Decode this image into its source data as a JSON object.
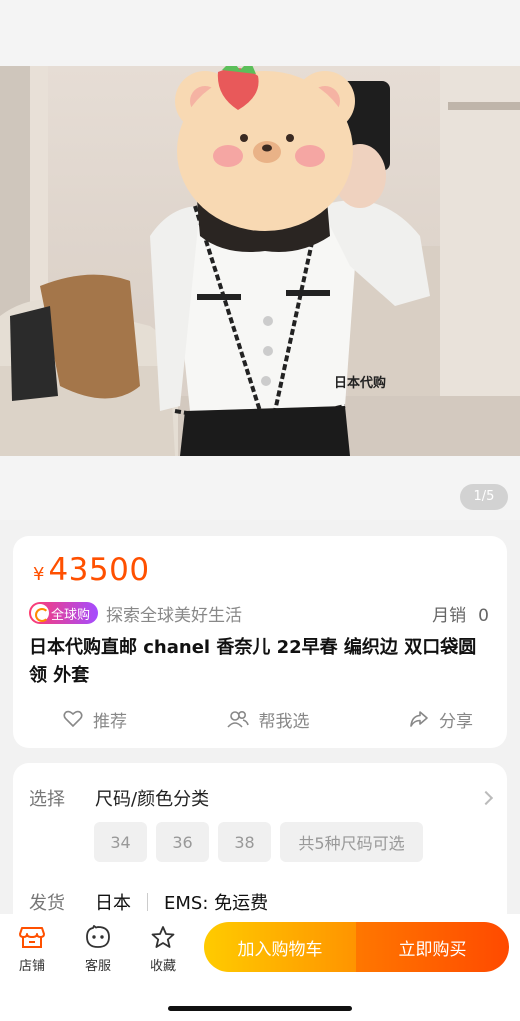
{
  "gallery": {
    "counter": "1/5",
    "photo_caption": "日本代购"
  },
  "product": {
    "currency": "¥",
    "price": "43500",
    "badge": "全球购",
    "slogan": "探索全球美好生活",
    "sales_label": "月销",
    "sales_count": "0",
    "title": "日本代购直邮 chanel 香奈儿 22早春 编织边 双口袋圆领 外套",
    "actions": {
      "recommend": "推荐",
      "help_choose": "帮我选",
      "share": "分享"
    }
  },
  "options": {
    "select_label": "选择",
    "select_value": "尺码/颜色分类",
    "sizes": [
      "34",
      "36",
      "38"
    ],
    "sizes_more": "共5种尺码可选",
    "ship_label": "发货",
    "ship_from": "日本",
    "ship_method": "EMS: 免运费"
  },
  "bottom_bar": {
    "shop": "店铺",
    "service": "客服",
    "favorite": "收藏",
    "add_to_cart": "加入购物车",
    "buy_now": "立即购买"
  },
  "colors": {
    "accent": "#ff5000",
    "cart_start": "#ffcb00",
    "buy_end": "#ff4a00"
  }
}
